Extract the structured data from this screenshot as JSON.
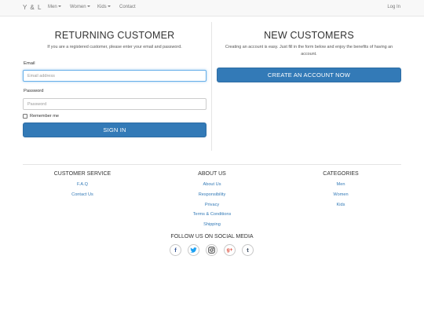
{
  "nav": {
    "brand": "Y & L",
    "items": [
      {
        "label": "Men",
        "dropdown": true
      },
      {
        "label": "Women",
        "dropdown": true
      },
      {
        "label": "Kids",
        "dropdown": true
      },
      {
        "label": "Contact",
        "dropdown": false
      }
    ],
    "login": "Log In"
  },
  "returning": {
    "title": "RETURNING CUSTOMER",
    "subtitle": "If you are a registered customer, please enter your email and password.",
    "email_label": "Email",
    "email_placeholder": "Email address",
    "email_value": "",
    "password_label": "Password",
    "password_placeholder": "Password",
    "password_value": "",
    "remember_label": "Remember me",
    "remember_checked": false,
    "signin_button": "SIGN IN"
  },
  "new_customers": {
    "title": "NEW CUSTOMERS",
    "text": "Creating an account is easy. Just fill in the form below and enjoy the benefits of having an account.",
    "create_button": "CREATE AN ACCOUNT NOW"
  },
  "footer": {
    "customer_service": {
      "title": "CUSTOMER SERVICE",
      "links": [
        "F.A.Q",
        "Contact Us"
      ]
    },
    "about": {
      "title": "ABOUT US",
      "links": [
        "About Us",
        "Responsibility",
        "Privacy",
        "Terms & Conditions",
        "Shipping"
      ]
    },
    "categories": {
      "title": "CATEGORIES",
      "links": [
        "Men",
        "Women",
        "Kids"
      ]
    },
    "social_title": "FOLLOW US ON SOCIAL MEDIA",
    "social": [
      {
        "icon": "facebook-icon",
        "glyph": "f",
        "color": "#3b5998"
      },
      {
        "icon": "twitter-icon",
        "glyph": "t",
        "color": "#1da1f2"
      },
      {
        "icon": "instagram-icon",
        "glyph": "ig",
        "color": "#333333"
      },
      {
        "icon": "google-plus-icon",
        "glyph": "g+",
        "color": "#dd4b39"
      },
      {
        "icon": "tumblr-icon",
        "glyph": "t",
        "color": "#35465c"
      }
    ]
  },
  "colors": {
    "primary": "#337ab7",
    "link": "#337ab7",
    "navbar_bg": "#f8f8f8"
  }
}
